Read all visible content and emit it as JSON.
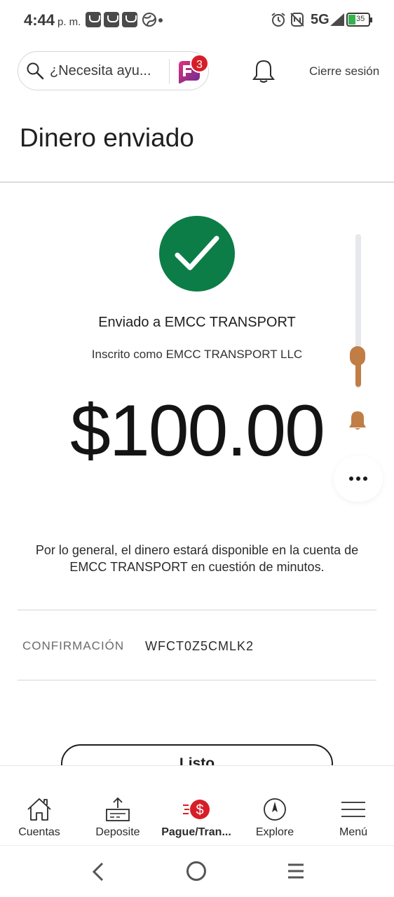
{
  "status_bar": {
    "time": "4:44",
    "ampm": "p. m.",
    "network": "5G",
    "battery": "35",
    "icons": [
      "app-icon",
      "app-icon",
      "app-icon",
      "globe-icon",
      "alarm-icon",
      "nfc-icon",
      "signal-icon",
      "battery-icon"
    ]
  },
  "header": {
    "search_placeholder": "¿Necesita ayu...",
    "assistant_badge_count": "3",
    "logout_label": "Cierre sesión"
  },
  "page": {
    "title": "Dinero enviado"
  },
  "confirmation": {
    "sent_to": "Enviado a EMCC TRANSPORT",
    "enrolled_as": "Inscrito como EMCC TRANSPORT LLC",
    "amount": "$100.00",
    "notice": "Por lo general, el dinero estará disponible en la cuenta de EMCC TRANSPORT en cuestión de minutos.",
    "conf_label": "CONFIRMACIÓN",
    "conf_number": "WFCT0Z5CMLK2",
    "done_label": "Listo"
  },
  "colors": {
    "success_green": "#0c7d46",
    "badge_red": "#d71e28",
    "accent_bronze": "#c07d45"
  },
  "bottom_nav": {
    "items": [
      {
        "label": "Cuentas",
        "icon": "home-icon"
      },
      {
        "label": "Deposite",
        "icon": "deposit-icon"
      },
      {
        "label": "Pague/Tran...",
        "icon": "pay-transfer-icon"
      },
      {
        "label": "Explore",
        "icon": "compass-icon"
      },
      {
        "label": "Menú",
        "icon": "hamburger-icon"
      }
    ],
    "active_index": 2
  }
}
